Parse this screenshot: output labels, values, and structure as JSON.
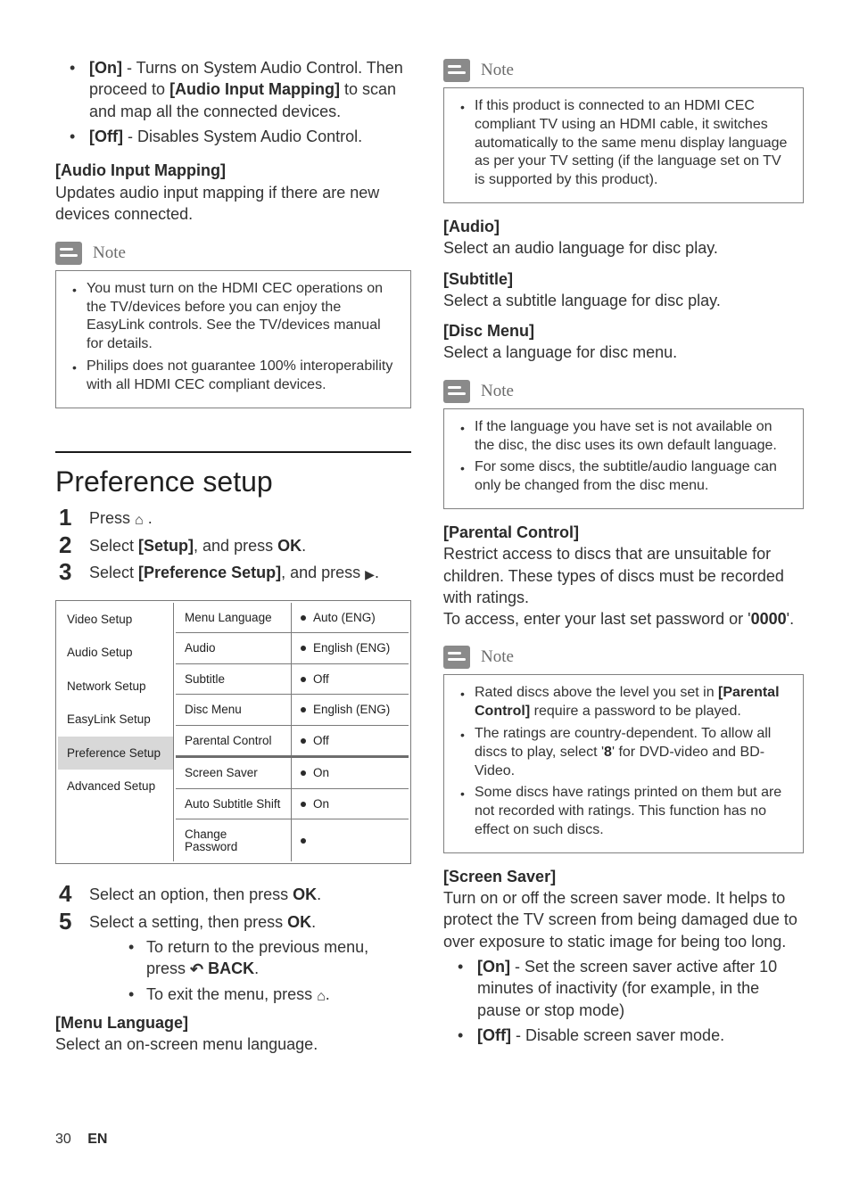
{
  "col1": {
    "intro_bullets": [
      {
        "tag": "[On]",
        "text": " - Turns on System Audio Control. Then proceed to ",
        "tag2": "[Audio Input Mapping]",
        "text2": " to scan and map all the connected devices."
      },
      {
        "tag": "[Off]",
        "text": " - Disables System Audio Control."
      }
    ],
    "aim_head": "[Audio Input Mapping]",
    "aim_body": "Updates audio input mapping if there are new devices connected.",
    "note1": {
      "title": "Note",
      "items": [
        "You must turn on the HDMI CEC operations on the TV/devices before you can enjoy the EasyLink controls. See the TV/devices manual for details.",
        "Philips does not guarantee 100% interoperability with all HDMI CEC compliant devices."
      ]
    },
    "section_title": "Preference setup",
    "steps_a": [
      {
        "pre": "Press ",
        "icon": "home",
        "post": " ."
      },
      {
        "pre": "Select ",
        "b1": "[Setup]",
        "mid": ", and press ",
        "b2": "OK",
        "post": "."
      },
      {
        "pre": "Select ",
        "b1": "[Preference Setup]",
        "mid": ", and press ",
        "icon": "play",
        "post": "."
      }
    ],
    "settings": {
      "left": [
        "Video Setup",
        "Audio Setup",
        "Network Setup",
        "EasyLink Setup",
        "Preference Setup",
        "Advanced Setup"
      ],
      "rows": [
        {
          "label": "Menu Language",
          "val": "Auto (ENG)"
        },
        {
          "label": "Audio",
          "val": "English (ENG)"
        },
        {
          "label": "Subtitle",
          "val": "Off"
        },
        {
          "label": "Disc Menu",
          "val": "English (ENG)"
        },
        {
          "label": "Parental Control",
          "val": "Off"
        },
        {
          "label": "Screen Saver",
          "val": "On",
          "thick": true
        },
        {
          "label": "Auto Subtitle Shift",
          "val": "On"
        },
        {
          "label": "Change Password",
          "val": ""
        }
      ],
      "selected_left_index": 4
    },
    "steps_b": [
      {
        "pre": "Select an option, then press ",
        "b1": "OK",
        "post": "."
      },
      {
        "pre": "Select a setting, then press ",
        "b1": "OK",
        "post": "."
      }
    ],
    "sub_bullets": [
      {
        "pre": "To return to the previous menu, press ",
        "icon": "back",
        "b1": " BACK",
        "post": "."
      },
      {
        "pre": "To exit the menu, press ",
        "icon": "home",
        "post": "."
      }
    ],
    "menu_lang_head": "[Menu Language]",
    "menu_lang_body": "Select an on-screen menu language."
  },
  "col2": {
    "note_top": {
      "title": "Note",
      "items": [
        "If this product is connected to an HDMI CEC compliant TV using an HDMI cable, it switches automatically to the same menu display language as per your TV setting (if the language set on TV is supported by this product)."
      ]
    },
    "audio_head": "[Audio]",
    "audio_body": "Select an audio language for disc play.",
    "sub_head": "[Subtitle]",
    "sub_body": "Select a subtitle language for disc play.",
    "dm_head": "[Disc Menu]",
    "dm_body": "Select a language for disc menu.",
    "note_lang": {
      "title": "Note",
      "items": [
        "If the language you have set is not available on the disc, the disc uses its own default language.",
        "For some discs, the subtitle/audio language can only be changed from the disc menu."
      ]
    },
    "pc_head": "[Parental Control]",
    "pc_body1": "Restrict access to discs that are unsuitable for children. These types of discs must be recorded with ratings.",
    "pc_body2a": "To access, enter your last set password or '",
    "pc_body2b": "0000",
    "pc_body2c": "'.",
    "note_pc": {
      "title": "Note",
      "items_rich": [
        {
          "pre": "Rated discs above the level you set in ",
          "b": "[Parental Control]",
          "post": " require a password to be played."
        },
        {
          "pre": "The ratings are country-dependent. To allow all discs to play, select '",
          "b": "8",
          "post": "' for DVD-video and BD-Video."
        },
        {
          "pre": "Some discs have ratings printed on them but are not recorded with ratings. This function has no effect on such discs.",
          "b": "",
          "post": ""
        }
      ]
    },
    "ss_head": "[Screen Saver]",
    "ss_body": "Turn on or off the screen saver mode. It helps to protect the TV screen from being damaged due to over exposure to static image for being too long.",
    "ss_bullets": [
      {
        "tag": "[On]",
        "text": " - Set the screen saver active after 10 minutes of inactivity (for example, in the pause or stop mode)"
      },
      {
        "tag": "[Off]",
        "text": " - Disable screen saver mode."
      }
    ]
  },
  "footer": {
    "page": "30",
    "lang": "EN"
  }
}
